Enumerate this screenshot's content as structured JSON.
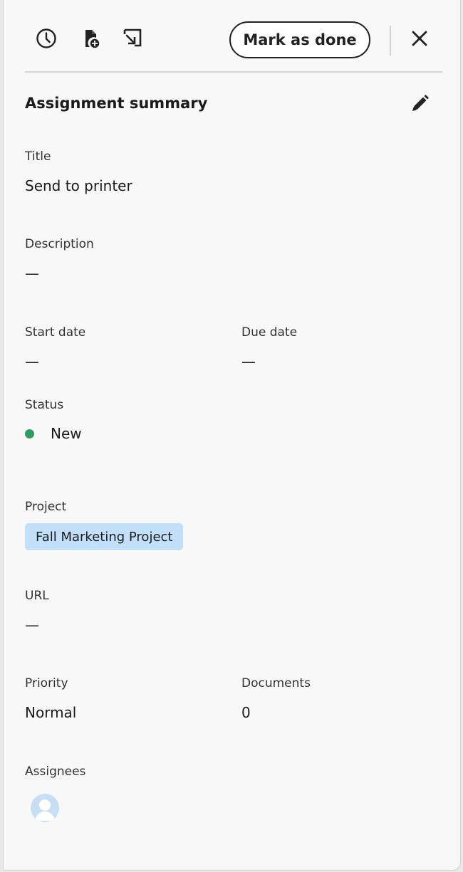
{
  "toolbar": {
    "history_icon": "clock-icon",
    "add_document_icon": "document-add-icon",
    "open_icon": "open-in-icon",
    "mark_done_label": "Mark as done",
    "close_icon": "close-icon"
  },
  "summary": {
    "title": "Assignment summary",
    "edit_icon": "pencil-icon"
  },
  "fields": {
    "title": {
      "label": "Title",
      "value": "Send to printer"
    },
    "description": {
      "label": "Description",
      "value": "—"
    },
    "start_date": {
      "label": "Start date",
      "value": "—"
    },
    "due_date": {
      "label": "Due date",
      "value": "—"
    },
    "status": {
      "label": "Status",
      "value": "New",
      "color": "#2d9d62"
    },
    "project": {
      "label": "Project",
      "value": "Fall Marketing Project",
      "tag_color": "#c3e0fb"
    },
    "url": {
      "label": "URL",
      "value": "—"
    },
    "priority": {
      "label": "Priority",
      "value": "Normal"
    },
    "documents": {
      "label": "Documents",
      "value": "0"
    },
    "assignees": {
      "label": "Assignees",
      "avatar_icon": "user-avatar-icon"
    }
  }
}
